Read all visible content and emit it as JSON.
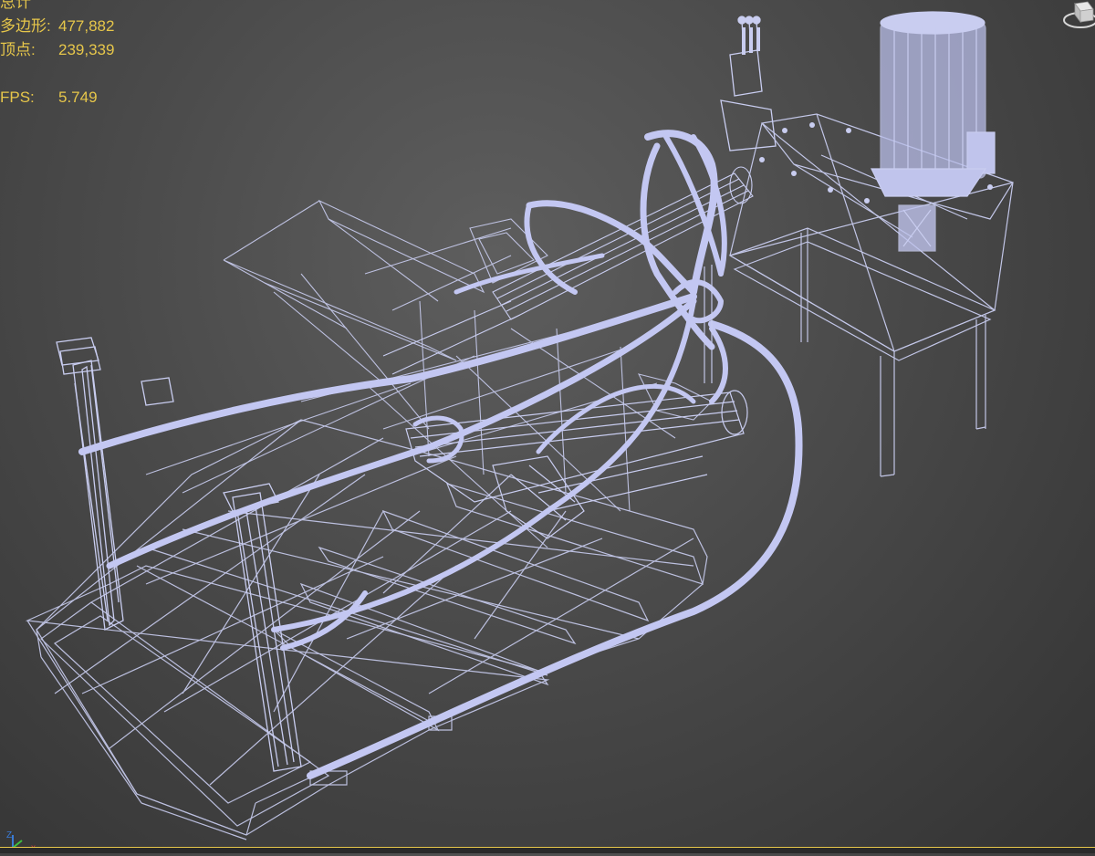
{
  "stats": {
    "total_label": "总计",
    "polygons_label": "多边形:",
    "polygons_value": "477,882",
    "vertices_label": "顶点:",
    "vertices_value": "239,339",
    "fps_label": "FPS:",
    "fps_value": "5.749"
  },
  "viewcube_icon": "viewcube-icon",
  "axis_tripod": {
    "icon": "axis-tripod-icon",
    "z_label": "Z",
    "x_label": "x"
  },
  "colors": {
    "wire": "#c9cdf0",
    "pipe": "#c3c7f2",
    "stats_text": "#e6c64a",
    "background": "#4a4a4a",
    "axis_z": "#3a7bd5",
    "axis_x": "#d23b3b",
    "axis_y": "#3fbf3f"
  }
}
